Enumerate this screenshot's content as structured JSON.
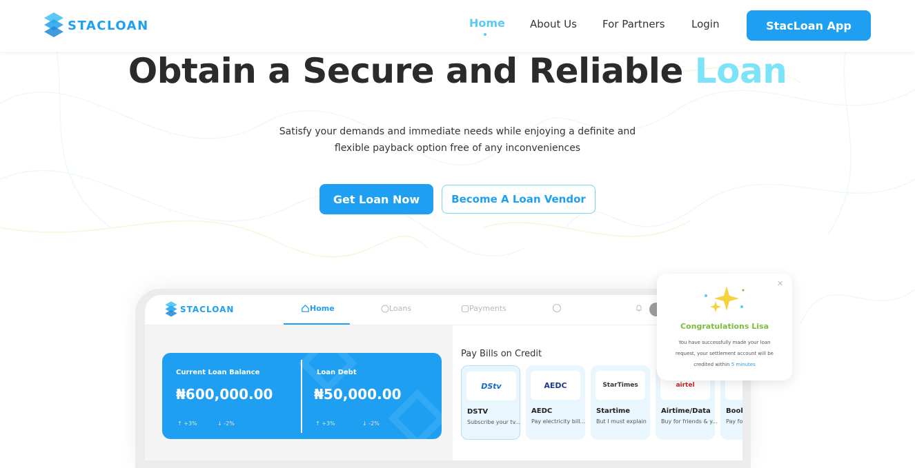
{
  "brand": {
    "name": "STACLOAN",
    "primary_color": "#1e9ff1",
    "accent_color": "#7de3f8"
  },
  "nav": {
    "links": [
      {
        "label": "Home",
        "active": true
      },
      {
        "label": "About Us",
        "active": false
      },
      {
        "label": "For Partners",
        "active": false
      },
      {
        "label": "Login",
        "active": false
      }
    ],
    "app_button": "StacLoan App"
  },
  "hero": {
    "title_main": "Obtain a Secure and Reliable ",
    "title_accent": "Loan",
    "subtitle_line1": "Satisfy your demands and immediate needs while enjoying a definite and",
    "subtitle_line2": "flexible payback option free of any inconveniences",
    "primary_cta": "Get Loan Now",
    "secondary_cta": "Become A Loan Vendor"
  },
  "mockup": {
    "brand": "STACLOAN",
    "tabs": [
      {
        "label": "Home",
        "icon": "home-icon",
        "active": true
      },
      {
        "label": "Loans",
        "icon": "loans-icon",
        "active": false
      },
      {
        "label": "Payments",
        "icon": "payments-icon",
        "active": false
      }
    ],
    "loan_card": {
      "balance_label": "Current Loan Balance",
      "balance_value": "₦600,000.00",
      "balance_up": "+3%",
      "balance_down": "-2%",
      "debt_label": "Loan Debt",
      "debt_value": "₦50,000.00",
      "debt_up": "+3%",
      "debt_down": "-2%"
    },
    "bills": {
      "title": "Pay Bills on Credit",
      "items": [
        {
          "logo": "DStv",
          "name": "DSTV",
          "desc": "Subscribe your tv..."
        },
        {
          "logo": "AEDC",
          "name": "AEDC",
          "desc": "Pay electricity bill..."
        },
        {
          "logo": "StarTimes",
          "name": "Startime",
          "desc": "But I must explain"
        },
        {
          "logo": "airtel",
          "name": "Airtime/Data",
          "desc": "Buy for friends & y..."
        },
        {
          "logo": "",
          "name": "Book",
          "desc": "Pay fo"
        }
      ]
    }
  },
  "toast": {
    "title": "Congratulations Lisa",
    "body_text": "You have successfully made your loan request, your settlement account will be credited within",
    "highlight": "5 minutes"
  }
}
